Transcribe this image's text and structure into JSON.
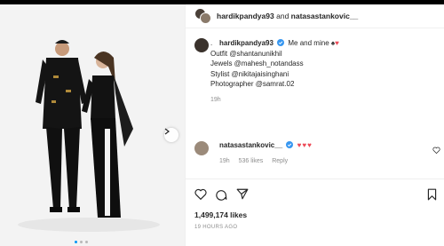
{
  "post": {
    "header_user1": "hardikpandya93",
    "header_and": "and",
    "header_user2": "natasastankovic__",
    "author": "hardikpandya93",
    "caption_text": "Me and mine ♠",
    "caption_lines": [
      ".",
      "Outfit @shantanunikhil",
      "Jewels @mahesh_notandass",
      "Stylist @nikitajaisinghani",
      "Photographer @samrat.02"
    ],
    "caption_age": "19h",
    "comment": {
      "user": "natasastankovic__",
      "text": "♥♥♥",
      "age": "19h",
      "likes": "536 likes",
      "reply": "Reply"
    },
    "likes_count": "1,499,174 likes",
    "timestamp": "19 HOURS AGO"
  },
  "colors": {
    "verified": "#3897f0",
    "heart": "#ed4956",
    "accent": "#0095f6"
  },
  "icons": [
    "heart-icon",
    "comment-icon",
    "share-icon",
    "bookmark-icon",
    "chevron-right-icon",
    "verified-icon"
  ]
}
